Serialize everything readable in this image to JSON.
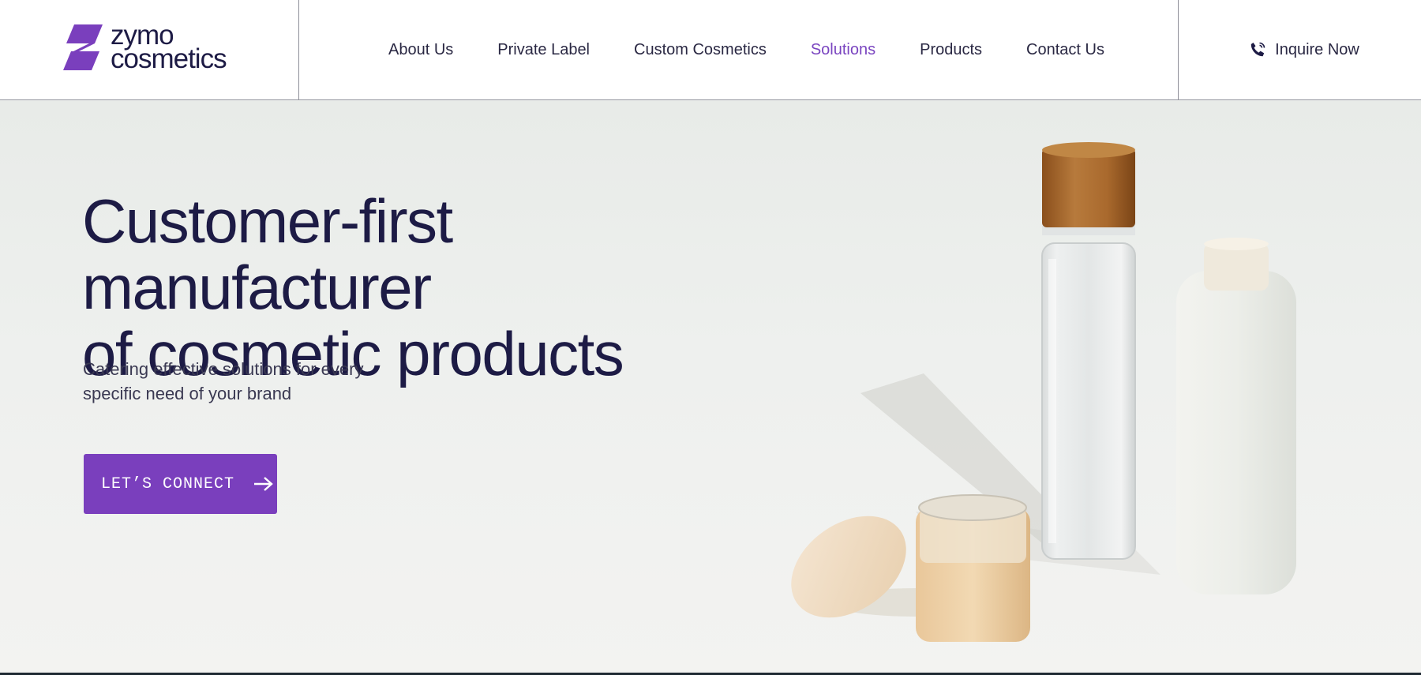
{
  "brand": {
    "name_line1": "zymo",
    "name_line2": "cosmetics",
    "logo_icon": "z-mark-icon",
    "accent_color": "#7a3fbd"
  },
  "nav": {
    "items": [
      {
        "label": "About Us",
        "active": false
      },
      {
        "label": "Private Label",
        "active": false
      },
      {
        "label": "Custom Cosmetics",
        "active": false
      },
      {
        "label": "Solutions",
        "active": true
      },
      {
        "label": "Products",
        "active": false
      },
      {
        "label": "Contact Us",
        "active": false
      }
    ],
    "inquire_label": "Inquire Now",
    "inquire_icon": "phone-icon"
  },
  "hero": {
    "headline_line1": "Customer-first manufacturer",
    "headline_line2": "of cosmetic products",
    "subtitle_line1": "Catering effective solutions for every",
    "subtitle_line2": "specific need of your brand",
    "cta_label": "LET’S CONNECT",
    "cta_icon": "arrow-right-icon",
    "image": "cosmetic-containers-image"
  }
}
